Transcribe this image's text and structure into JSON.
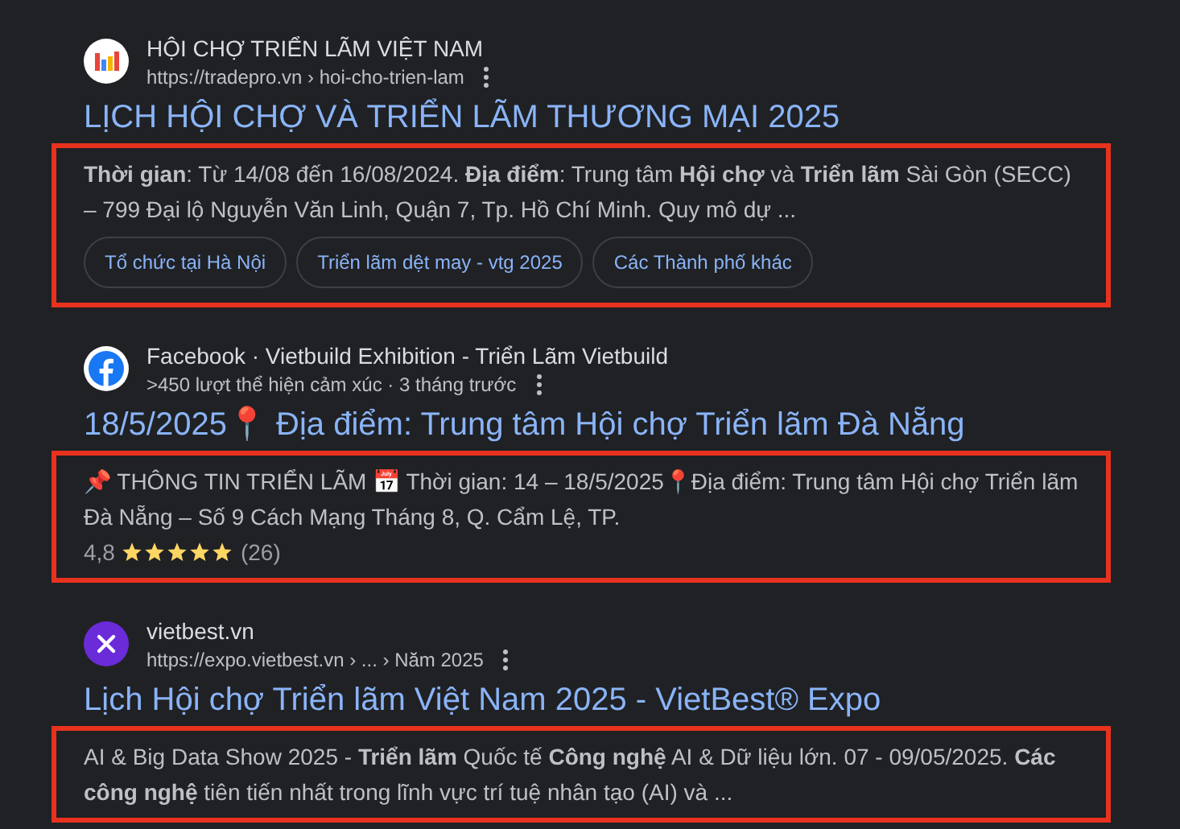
{
  "results": [
    {
      "kind": "chart",
      "site": "HỘI CHỢ TRIỂN LÃM VIỆT NAM",
      "url": "https://tradepro.vn › hoi-cho-trien-lam",
      "title": "LỊCH HỘI CHỢ VÀ TRIỂN LÃM THƯƠNG MẠI 2025",
      "highlighted": true,
      "snippet": "**Thời gian**: Từ 14/08 đến 16/08/2024. **Địa điểm**: Trung tâm **Hội chợ** và **Triển lãm** Sài Gòn (SECC) – 799 Đại lộ Nguyễn Văn Linh, Quận 7, Tp. Hồ Chí Minh. Quy mô dự ...",
      "chips": [
        "Tổ chức tại Hà Nội",
        "Triển lãm dệt may - vtg 2025",
        "Các Thành phố khác"
      ]
    },
    {
      "kind": "facebook",
      "site": "Facebook · Vietbuild Exhibition - Triển Lãm Vietbuild",
      "url": ">450 lượt thể hiện cảm xúc · 3 tháng trước",
      "title": "18/5/2025📍 Địa điểm: Trung tâm Hội chợ Triển lãm Đà Nẵng",
      "highlighted": true,
      "snippet": "📌 THÔNG TIN TRIỂN LÃM 📅 Thời gian: 14 – 18/5/2025📍Địa điểm: Trung tâm Hội chợ Triển lãm Đà Nẵng – Số 9 Cách Mạng Tháng 8, Q. Cẩm Lệ, TP.",
      "rating": "4,8",
      "stars": 5,
      "reviews": "(26)"
    },
    {
      "kind": "cross",
      "site": "vietbest.vn",
      "url": "https://expo.vietbest.vn › ... › Năm 2025",
      "title": "Lịch Hội chợ Triển lãm Việt Nam 2025 - VietBest® Expo",
      "highlighted": true,
      "snippet": "AI & Big Data Show 2025 - **Triển lãm** Quốc tế **Công nghệ** AI & Dữ liệu lớn. 07 - 09/05/2025. **Các công nghệ** tiên tiến nhất trong lĩnh vực trí tuệ nhân tạo (AI) và ..."
    }
  ]
}
